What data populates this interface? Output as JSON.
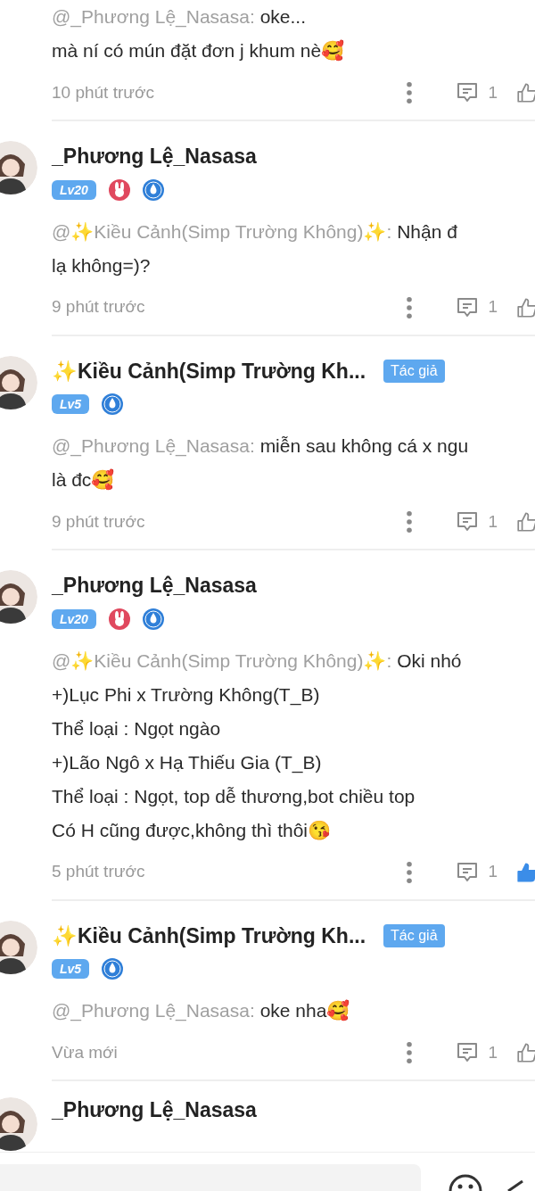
{
  "comments": [
    {
      "mention": "@_Phương Lệ_Nasasa:",
      "lines": [
        "oke...",
        "mà ní có mún đặt đơn j khum nè🥰"
      ],
      "time": "10 phút trước",
      "reply_count": "1",
      "liked": false
    },
    {
      "author": {
        "name": "_Phương Lệ_Nasasa",
        "level": "Lv20",
        "badges": [
          {
            "kind": "rabbit"
          },
          {
            "kind": "drop"
          }
        ]
      },
      "mention": "@✨Kiều Cảnh(Simp Trường Không)✨:",
      "lines": [
        "Nhận đ",
        "lạ không=)?"
      ],
      "time": "9 phút trước",
      "reply_count": "1",
      "liked": false
    },
    {
      "author": {
        "name": "✨Kiều Cảnh(Simp Trường Kh...",
        "tag": "Tác giả",
        "level": "Lv5",
        "badges": [
          {
            "kind": "drop"
          }
        ]
      },
      "mention": "@_Phương Lệ_Nasasa:",
      "lines": [
        "miễn sau không cá x ngu",
        "là đc🥰"
      ],
      "time": "9 phút trước",
      "reply_count": "1",
      "liked": false
    },
    {
      "author": {
        "name": "_Phương Lệ_Nasasa",
        "level": "Lv20",
        "badges": [
          {
            "kind": "rabbit"
          },
          {
            "kind": "drop"
          }
        ]
      },
      "mention": "@✨Kiều Cảnh(Simp Trường Không)✨:",
      "lines": [
        "Oki nhó",
        "+)Lục Phi x Trường Không(T_B)",
        "Thể loại : Ngọt ngào",
        "+)Lão Ngô x Hạ Thiếu Gia (T_B)",
        "Thể loại : Ngọt, top dễ thương,bot chiều top",
        "Có H cũng được,không thì thôi😘"
      ],
      "time": "5 phút trước",
      "reply_count": "1",
      "liked": true
    },
    {
      "author": {
        "name": "✨Kiều Cảnh(Simp Trường Kh...",
        "tag": "Tác giả",
        "level": "Lv5",
        "badges": [
          {
            "kind": "drop"
          }
        ]
      },
      "mention": "@_Phương Lệ_Nasasa:",
      "lines": [
        "oke nha🥰"
      ],
      "time": "Vừa mới",
      "reply_count": "1",
      "liked": false
    }
  ],
  "next_comment": {
    "name": "_Phương Lệ_Nasasa"
  }
}
